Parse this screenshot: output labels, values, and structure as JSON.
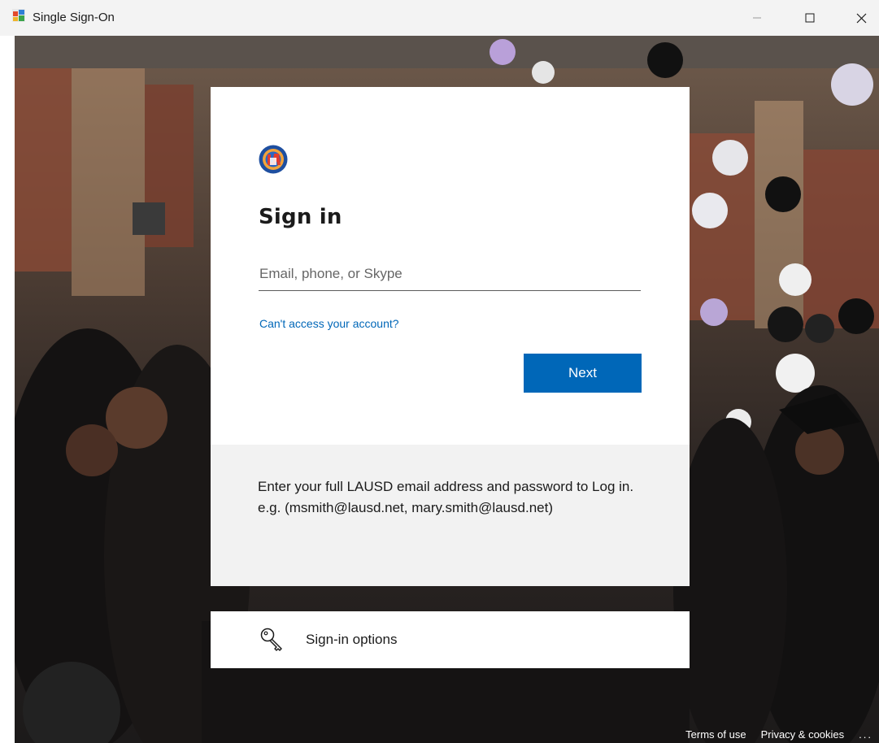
{
  "window": {
    "title": "Single Sign-On",
    "controls": [
      "minimize-icon",
      "maximize-icon",
      "close-icon"
    ]
  },
  "signin": {
    "title": "Sign in",
    "email_placeholder": "Email, phone, or Skype",
    "email_value": "",
    "cant_access_link": "Can't access your account?",
    "next_label": "Next",
    "help_text": "Enter your full LAUSD email address and password to Log in. e.g. (msmith@lausd.net, mary.smith@lausd.net)"
  },
  "options": {
    "label": "Sign-in options",
    "icon": "key-icon"
  },
  "footer": {
    "terms": "Terms of use",
    "privacy": "Privacy & cookies",
    "more": "..."
  },
  "colors": {
    "accent": "#0067b8",
    "titlebar": "#f3f3f3",
    "help_panel": "#f2f2f2"
  }
}
